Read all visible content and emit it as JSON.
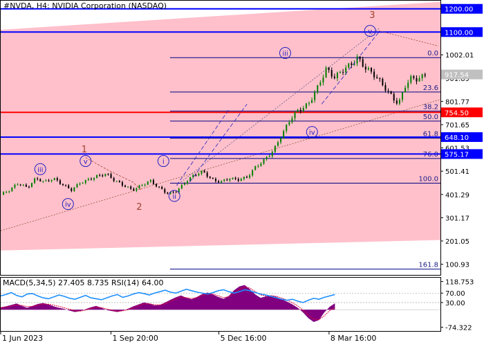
{
  "header": {
    "title": "#NVDA, H4:  NVIDIA Corporation (NASDAQ)"
  },
  "colors": {
    "channel_fill": "#ffc0cb",
    "level_blue": "#0000ff",
    "level_red": "#ff0000",
    "fib_line": "#000080",
    "wave_brown": "#a0412d",
    "wave_circle": "#2020c0",
    "bull_candle": "#008000",
    "bear_candle": "#000000",
    "macd_hist": "#800080",
    "macd_signal": "#e0003a",
    "rsi_line": "#1e90ff",
    "axis_text": "#000000"
  },
  "chart_data": [
    {
      "type": "candlestick",
      "title": "#NVDA, H4:  NVIDIA Corporation (NASDAQ)",
      "ylim": [
        55,
        1235
      ],
      "y_ticks": [
        {
          "value": 1002.01,
          "label": "1002.01"
        },
        {
          "value": 901.89,
          "label": "901.89"
        },
        {
          "value": 801.77,
          "label": "801.77"
        },
        {
          "value": 701.65,
          "label": "701.65"
        },
        {
          "value": 601.53,
          "label": "601.53"
        },
        {
          "value": 501.41,
          "label": "501.41"
        },
        {
          "value": 401.29,
          "label": "401.29"
        },
        {
          "value": 301.17,
          "label": "301.17"
        },
        {
          "value": 201.05,
          "label": "201.05"
        },
        {
          "value": 100.93,
          "label": "100.93"
        }
      ],
      "x_ticks": [
        {
          "t": 0.0,
          "label": "1 Jun 2023"
        },
        {
          "t": 0.2507,
          "label": "1 Sep 20:00"
        },
        {
          "t": 0.4962,
          "label": "5 Dec 16:00"
        },
        {
          "t": 0.7467,
          "label": "8 Mar 16:00"
        }
      ],
      "price_path": [
        [
          0.0,
          400
        ],
        [
          0.02,
          420
        ],
        [
          0.04,
          450
        ],
        [
          0.06,
          430
        ],
        [
          0.08,
          470
        ],
        [
          0.1,
          455
        ],
        [
          0.12,
          470
        ],
        [
          0.14,
          445
        ],
        [
          0.16,
          420
        ],
        [
          0.18,
          450
        ],
        [
          0.2,
          465
        ],
        [
          0.22,
          480
        ],
        [
          0.24,
          490
        ],
        [
          0.26,
          460
        ],
        [
          0.28,
          440
        ],
        [
          0.3,
          420
        ],
        [
          0.32,
          440
        ],
        [
          0.34,
          460
        ],
        [
          0.36,
          430
        ],
        [
          0.38,
          405
        ],
        [
          0.4,
          415
        ],
        [
          0.42,
          455
        ],
        [
          0.44,
          485
        ],
        [
          0.46,
          500
        ],
        [
          0.48,
          465
        ],
        [
          0.5,
          455
        ],
        [
          0.52,
          470
        ],
        [
          0.54,
          465
        ],
        [
          0.56,
          475
        ],
        [
          0.58,
          520
        ],
        [
          0.6,
          550
        ],
        [
          0.62,
          590
        ],
        [
          0.64,
          660
        ],
        [
          0.66,
          730
        ],
        [
          0.675,
          760
        ],
        [
          0.7,
          790
        ],
        [
          0.72,
          860
        ],
        [
          0.74,
          940
        ],
        [
          0.76,
          905
        ],
        [
          0.78,
          940
        ],
        [
          0.8,
          965
        ],
        [
          0.81,
          990
        ],
        [
          0.83,
          945
        ],
        [
          0.85,
          915
        ],
        [
          0.87,
          870
        ],
        [
          0.89,
          820
        ],
        [
          0.905,
          790
        ],
        [
          0.92,
          870
        ],
        [
          0.935,
          905
        ],
        [
          0.95,
          895
        ],
        [
          0.965,
          917.54
        ]
      ],
      "horizontal_levels": [
        {
          "value": 1200.0,
          "label": "1200.00",
          "color": "#0000ff",
          "width": 2
        },
        {
          "value": 1100.0,
          "label": "1100.00",
          "color": "#0000ff",
          "width": 2
        },
        {
          "value": 754.5,
          "label": "754.50",
          "color": "#ff0000",
          "width": 2
        },
        {
          "value": 648.1,
          "label": "648.10",
          "color": "#0000ff",
          "width": 2
        },
        {
          "value": 575.17,
          "label": "575.17",
          "color": "#0000ff",
          "width": 2
        }
      ],
      "current_price": {
        "value": 917.54,
        "label": "917.54"
      },
      "fibonacci": {
        "x_start": 0.385,
        "levels": [
          {
            "value": 990,
            "label": "0.0"
          },
          {
            "value": 842,
            "label": "23.6"
          },
          {
            "value": 760,
            "label": "38.2"
          },
          {
            "value": 717,
            "label": "50.0"
          },
          {
            "value": 643,
            "label": "61.8"
          },
          {
            "value": 556,
            "label": "76.0"
          },
          {
            "value": 450,
            "label": "100.0"
          },
          {
            "value": 80,
            "label": "161.8"
          }
        ]
      },
      "channel": [
        {
          "t": 0.0,
          "upper": 1110,
          "lower": 160
        },
        {
          "t": 1.0,
          "upper": 1230,
          "lower": 205
        }
      ],
      "wave_labels": [
        {
          "label": "iii",
          "t": 0.09,
          "value": 510,
          "style": "circle"
        },
        {
          "label": "iv",
          "t": 0.153,
          "value": 360,
          "style": "circle"
        },
        {
          "label": "v",
          "t": 0.193,
          "value": 545,
          "style": "circle"
        },
        {
          "label": "1",
          "t": 0.19,
          "value": 598,
          "style": "plain"
        },
        {
          "label": "2",
          "t": 0.315,
          "value": 350,
          "style": "plain"
        },
        {
          "label": "i",
          "t": 0.37,
          "value": 545,
          "style": "circle"
        },
        {
          "label": "ii",
          "t": 0.395,
          "value": 395,
          "style": "circle"
        },
        {
          "label": "iii",
          "t": 0.647,
          "value": 1010,
          "style": "circle"
        },
        {
          "label": "iv",
          "t": 0.708,
          "value": 670,
          "style": "circle"
        },
        {
          "label": "v",
          "t": 0.84,
          "value": 1105,
          "style": "circle"
        },
        {
          "label": "3",
          "t": 0.845,
          "value": 1175,
          "style": "plain"
        }
      ]
    },
    {
      "type": "line",
      "title": "MACD(5,34,5) 27.405 8.735 RSI(14) 64.00",
      "ylim": [
        -90,
        135
      ],
      "y_ticks": [
        {
          "value": 118.753,
          "label": "118.753"
        },
        {
          "value": 70.0,
          "label": "70.00"
        },
        {
          "value": 30.0,
          "label": "30.00"
        },
        {
          "value": -74.322,
          "label": "-74.322"
        }
      ],
      "series": [
        {
          "name": "MACD",
          "values": [
            10,
            14,
            20,
            26,
            16,
            8,
            16,
            24,
            28,
            22,
            14,
            8,
            3,
            -4,
            -10,
            -6,
            2,
            10,
            16,
            8,
            -2,
            -6,
            -10,
            -4,
            4,
            14,
            22,
            30,
            26,
            18,
            20,
            30,
            42,
            52,
            60,
            50,
            44,
            54,
            66,
            72,
            64,
            54,
            46,
            58,
            82,
            98,
            104,
            86,
            64,
            50,
            56,
            60,
            54,
            44,
            34,
            22,
            8,
            -12,
            -36,
            -52,
            -44,
            -12,
            12,
            27
          ]
        },
        {
          "name": "Signal",
          "values": [
            8,
            11,
            15,
            20,
            18,
            13,
            14,
            19,
            24,
            23,
            19,
            14,
            8,
            2,
            -5,
            -6,
            -2,
            5,
            11,
            9,
            3,
            -2,
            -7,
            -5,
            0,
            8,
            16,
            24,
            25,
            21,
            20,
            25,
            35,
            45,
            53,
            51,
            47,
            51,
            60,
            67,
            66,
            59,
            51,
            55,
            70,
            86,
            96,
            91,
            76,
            62,
            58,
            59,
            56,
            49,
            40,
            29,
            16,
            -2,
            -22,
            -40,
            -42,
            -26,
            -4,
            8.7
          ]
        },
        {
          "name": "RSI",
          "values": [
            58,
            64,
            72,
            60,
            54,
            66,
            68,
            58,
            50,
            46,
            54,
            62,
            56,
            48,
            44,
            52,
            60,
            50,
            46,
            42,
            50,
            58,
            64,
            52,
            58,
            66,
            72,
            68,
            62,
            70,
            76,
            82,
            74,
            70,
            78,
            86,
            80,
            74,
            70,
            66,
            72,
            80,
            84,
            76,
            70,
            76,
            84,
            80,
            72,
            66,
            62,
            56,
            50,
            44,
            40,
            44,
            36,
            30,
            40,
            48,
            44,
            52,
            58,
            64
          ]
        }
      ]
    }
  ]
}
